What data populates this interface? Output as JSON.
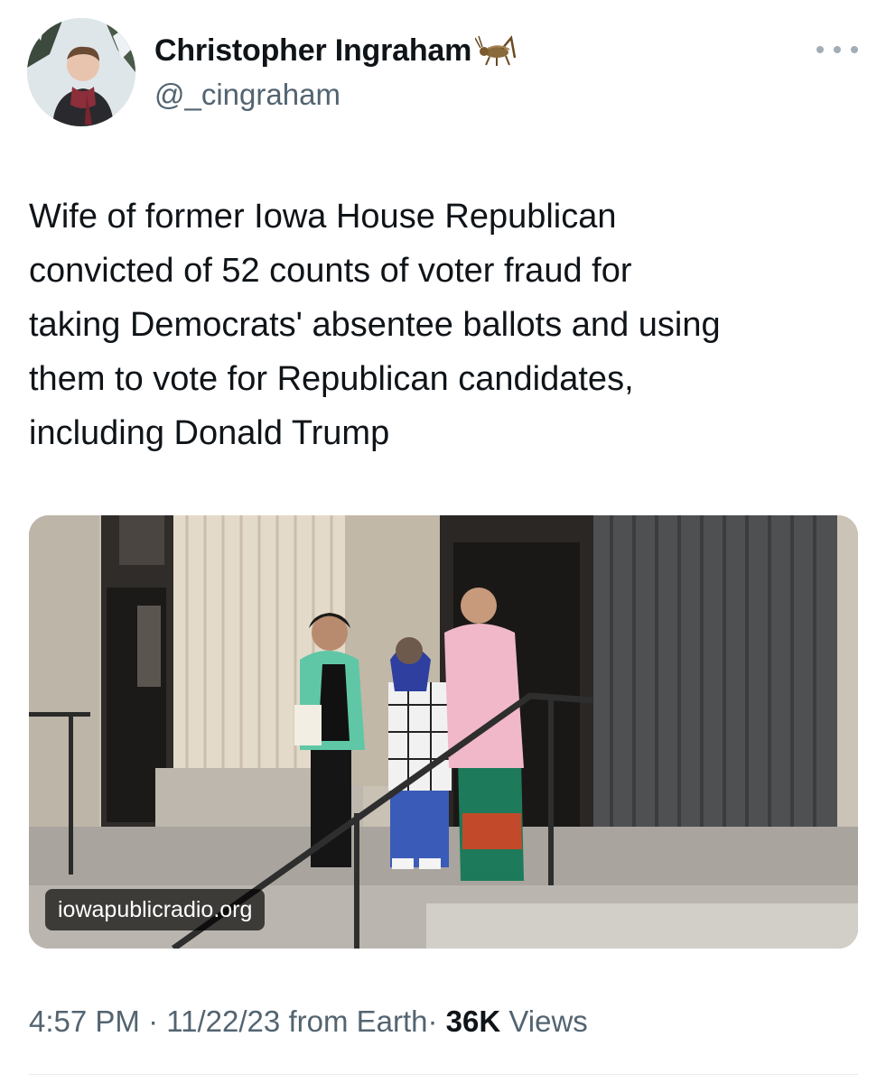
{
  "tweet": {
    "author": {
      "display_name": "Christopher Ingraham",
      "name_emoji": "cricket-emoji",
      "handle": "@_cingraham",
      "avatar": "avatar-photo"
    },
    "more_icon": "more-horizontal-icon",
    "text_lines": [
      "Wife of former Iowa House Republican",
      "convicted of 52 counts of voter fraud for",
      "taking Democrats' absentee ballots and using",
      "them to vote for Republican candidates,",
      "including Donald Trump"
    ],
    "media": {
      "source": "iowapublicradio.org"
    },
    "meta": {
      "time": "4:57 PM",
      "separator": "·",
      "date": "11/22/23",
      "source_prefix": "from",
      "source": "Earth",
      "views_count": "36K",
      "views_label": "Views"
    }
  },
  "colors": {
    "text_primary": "#0f1419",
    "text_secondary": "#536471",
    "divider": "#e6ecf0"
  }
}
